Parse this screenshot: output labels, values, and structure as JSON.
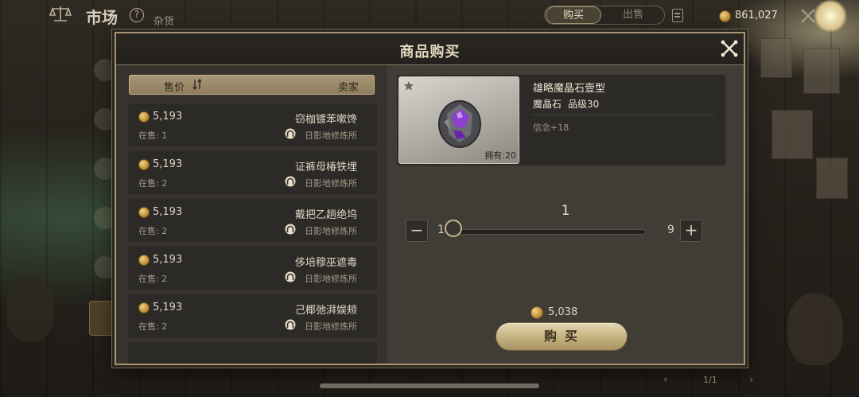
{
  "topbar": {
    "title": "市场",
    "help": "?",
    "subtitle": "杂货",
    "tab_buy": "购买",
    "tab_sell": "出售",
    "gold": "861,027"
  },
  "pager": {
    "text": "1/1",
    "prev": "‹",
    "next": "›"
  },
  "modal": {
    "title": "商品购买",
    "list_header": {
      "price": "售价",
      "seller": "卖家"
    },
    "listings": [
      {
        "price": "5,193",
        "name": "窃枷镀苯嗽馋",
        "stock": "在售: 1",
        "seller": "日影地修炼所"
      },
      {
        "price": "5,193",
        "name": "证裤母椿铁埋",
        "stock": "在售: 2",
        "seller": "日影地修炼所"
      },
      {
        "price": "5,193",
        "name": "戴把乙趟绝坞",
        "stock": "在售: 2",
        "seller": "日影地修炼所"
      },
      {
        "price": "5,193",
        "name": "侈培穆巫遮毒",
        "stock": "在售: 2",
        "seller": "日影地修炼所"
      },
      {
        "price": "5,193",
        "name": "己椰弛湃娱颊",
        "stock": "在售: 2",
        "seller": "日影地修炼所"
      }
    ],
    "item": {
      "name": "雄略魔晶石壹型",
      "type": "魔晶石",
      "grade": "品级30",
      "stat": "信念+18",
      "owned": "拥有:20"
    },
    "quantity": {
      "value": "1",
      "min": "1",
      "max": "9",
      "fraction": 0,
      "minus": "−",
      "plus": "+"
    },
    "total_price": "5,038",
    "buy_label": "购买"
  },
  "colors": {
    "accent_gold": "#c7b482",
    "panel_dark": "#2c2a26",
    "gem_purple": "#8e3fd1"
  }
}
